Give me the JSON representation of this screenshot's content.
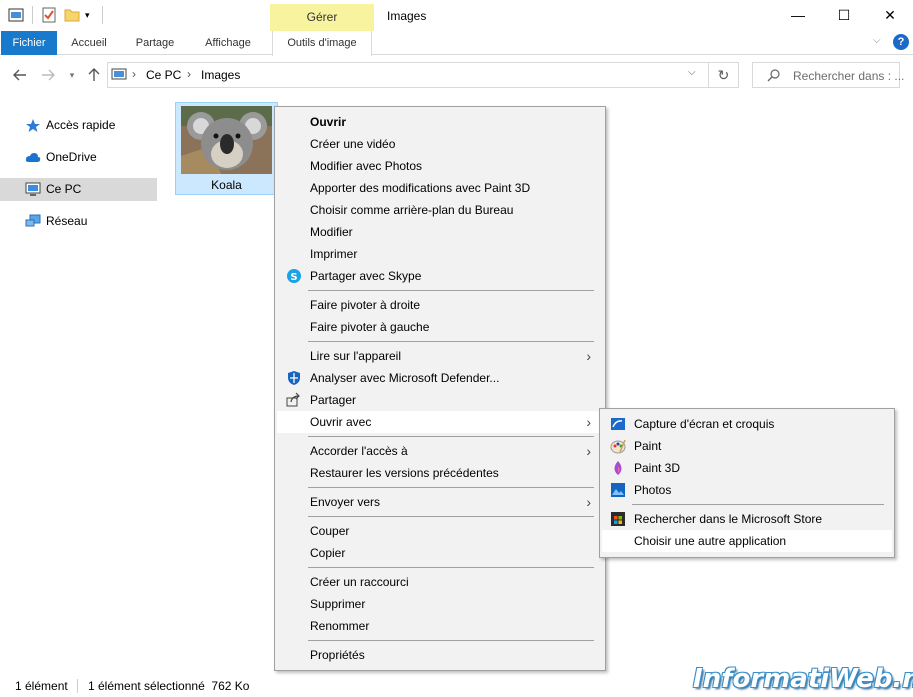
{
  "title_bar": {
    "context_tab": "Gérer",
    "window_title": "Images",
    "minimize_glyph": "—",
    "maximize_glyph": "☐",
    "close_glyph": "✕"
  },
  "ribbon": {
    "tabs": [
      "Fichier",
      "Accueil",
      "Partage",
      "Affichage",
      "Outils d'image"
    ],
    "help_glyph": "?",
    "chevron_glyph": "⌵",
    "accent_color": "#1979ca"
  },
  "address": {
    "breadcrumb": [
      "Ce PC",
      "Images"
    ],
    "separator": "›",
    "search_placeholder": "Rechercher dans : ..."
  },
  "sidebar": {
    "items": [
      {
        "label": "Accès rapide",
        "icon": "star-icon"
      },
      {
        "label": "OneDrive",
        "icon": "cloud-icon"
      },
      {
        "label": "Ce PC",
        "icon": "computer-icon",
        "selected": true
      },
      {
        "label": "Réseau",
        "icon": "network-icon"
      }
    ]
  },
  "files": [
    {
      "name": "Koala",
      "selected": true
    }
  ],
  "context_menu": {
    "items": [
      {
        "label": "Ouvrir",
        "bold": true
      },
      {
        "label": "Créer une vidéo"
      },
      {
        "label": "Modifier avec Photos"
      },
      {
        "label": "Apporter des modifications avec Paint 3D"
      },
      {
        "label": "Choisir comme arrière-plan du Bureau"
      },
      {
        "label": "Modifier"
      },
      {
        "label": "Imprimer"
      },
      {
        "label": "Partager avec Skype",
        "icon": "skype-icon"
      },
      {
        "label": "Faire pivoter à droite"
      },
      {
        "label": "Faire pivoter à gauche"
      },
      {
        "label": "Lire sur l'appareil",
        "submenu": true
      },
      {
        "label": "Analyser avec Microsoft Defender...",
        "icon": "defender-icon"
      },
      {
        "label": "Partager",
        "icon": "share-icon"
      },
      {
        "label": "Ouvrir avec",
        "submenu": true,
        "highlighted": true
      },
      {
        "label": "Accorder l'accès à",
        "submenu": true
      },
      {
        "label": "Restaurer les versions précédentes"
      },
      {
        "label": "Envoyer vers",
        "submenu": true
      },
      {
        "label": "Couper"
      },
      {
        "label": "Copier"
      },
      {
        "label": "Créer un raccourci"
      },
      {
        "label": "Supprimer"
      },
      {
        "label": "Renommer"
      },
      {
        "label": "Propriétés"
      }
    ],
    "arrow_glyph": "›"
  },
  "open_with_submenu": {
    "items": [
      {
        "label": "Capture d'écran et croquis",
        "icon": "snip-sketch-icon"
      },
      {
        "label": "Paint",
        "icon": "paint-icon"
      },
      {
        "label": "Paint 3D",
        "icon": "paint3d-icon"
      },
      {
        "label": "Photos",
        "icon": "photos-icon"
      },
      {
        "label": "Rechercher dans le Microsoft Store",
        "icon": "store-icon"
      },
      {
        "label": "Choisir une autre application",
        "highlighted": true
      }
    ]
  },
  "status_bar": {
    "count": "1 élément",
    "selected": "1 élément sélectionné  762 Ko"
  },
  "watermark": "InformatiWeb.net"
}
